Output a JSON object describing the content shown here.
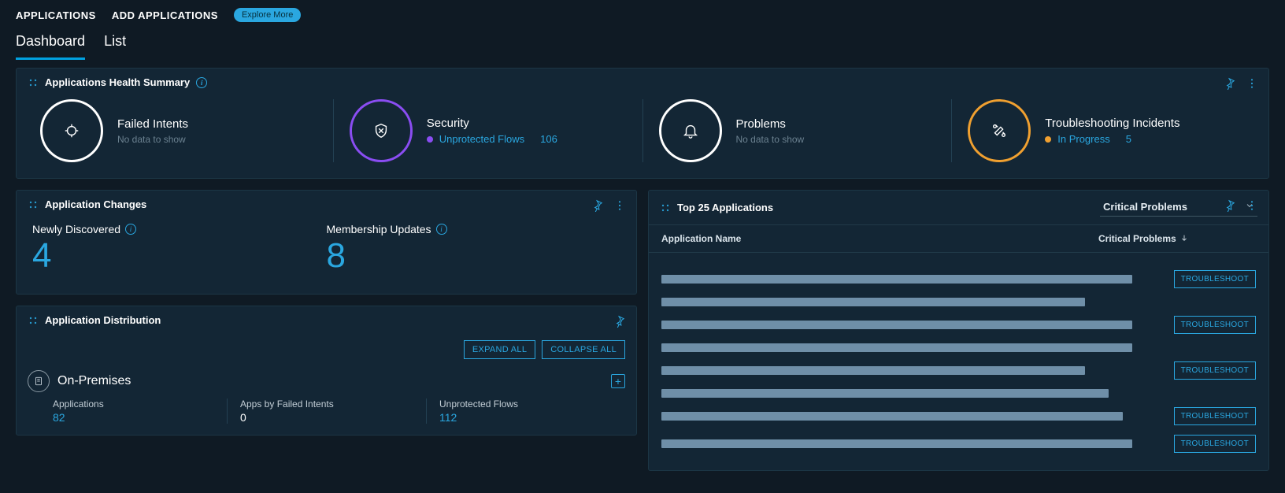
{
  "nav": {
    "primary": [
      "APPLICATIONS",
      "ADD APPLICATIONS"
    ],
    "explore": "Explore More",
    "tabs": [
      "Dashboard",
      "List"
    ],
    "activeTab": 0
  },
  "healthSummary": {
    "title": "Applications Health Summary",
    "items": [
      {
        "title": "Failed Intents",
        "sub": "No data to show",
        "ring": "white",
        "icon": "target"
      },
      {
        "title": "Security",
        "linkLabel": "Unprotected Flows",
        "linkValue": "106",
        "ring": "purple",
        "icon": "shield",
        "dot": "purple"
      },
      {
        "title": "Problems",
        "sub": "No data to show",
        "ring": "white",
        "icon": "bell"
      },
      {
        "title": "Troubleshooting Incidents",
        "linkLabel": "In Progress",
        "linkValue": "5",
        "ring": "orange",
        "icon": "tools",
        "dot": "orange"
      }
    ]
  },
  "appChanges": {
    "title": "Application Changes",
    "metrics": [
      {
        "label": "Newly Discovered",
        "value": "4"
      },
      {
        "label": "Membership Updates",
        "value": "8"
      }
    ]
  },
  "appDistribution": {
    "title": "Application Distribution",
    "buttons": {
      "expand": "EXPAND ALL",
      "collapse": "COLLAPSE ALL"
    },
    "group": "On-Premises",
    "stats": [
      {
        "label": "Applications",
        "value": "82",
        "link": true
      },
      {
        "label": "Apps by Failed Intents",
        "value": "0",
        "link": false
      },
      {
        "label": "Unprotected Flows",
        "value": "112",
        "link": true
      }
    ]
  },
  "topApps": {
    "title": "Top 25 Applications",
    "filter": {
      "label": "Critical Problems"
    },
    "columns": {
      "name": "Application Name",
      "problems": "Critical Problems"
    },
    "troubleshoot": "TROUBLESHOOT",
    "rows": [
      {
        "barPct": 99,
        "btn": true
      },
      {
        "barPct": 89,
        "btn": false
      },
      {
        "barPct": 99,
        "btn": true
      },
      {
        "barPct": 99,
        "btn": false
      },
      {
        "barPct": 89,
        "btn": true
      },
      {
        "barPct": 94,
        "btn": false
      },
      {
        "barPct": 97,
        "btn": true
      },
      {
        "barPct": 99,
        "btn": true
      }
    ]
  }
}
